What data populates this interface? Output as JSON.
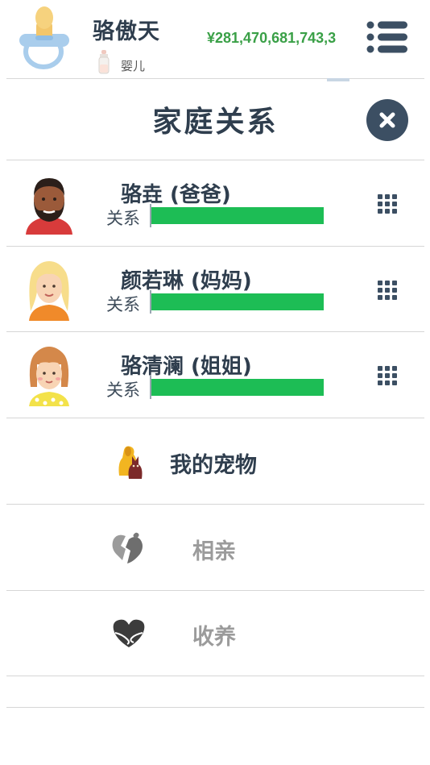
{
  "player": {
    "name": "骆傲天",
    "life_stage": "婴儿",
    "money": "¥281,470,681,743,3"
  },
  "panel": {
    "title": "家庭关系"
  },
  "family": [
    {
      "name": "骆垚 (爸爸)",
      "relationship_label": "关系",
      "relationship_level": 1.0
    },
    {
      "name": "颜若琳 (妈妈)",
      "relationship_label": "关系",
      "relationship_level": 1.0
    },
    {
      "name": "骆清澜 (姐姐)",
      "relationship_label": "关系",
      "relationship_level": 1.0
    }
  ],
  "actions": {
    "pets": "我的宠物",
    "dating": "相亲",
    "adopt": "收养"
  },
  "colors": {
    "text_dark": "#2f3e4e",
    "money_green": "#3aa047",
    "relationship_bar": "#1dbd55",
    "disabled_text": "#9b9b9b",
    "close_button": "#3c4f63"
  }
}
